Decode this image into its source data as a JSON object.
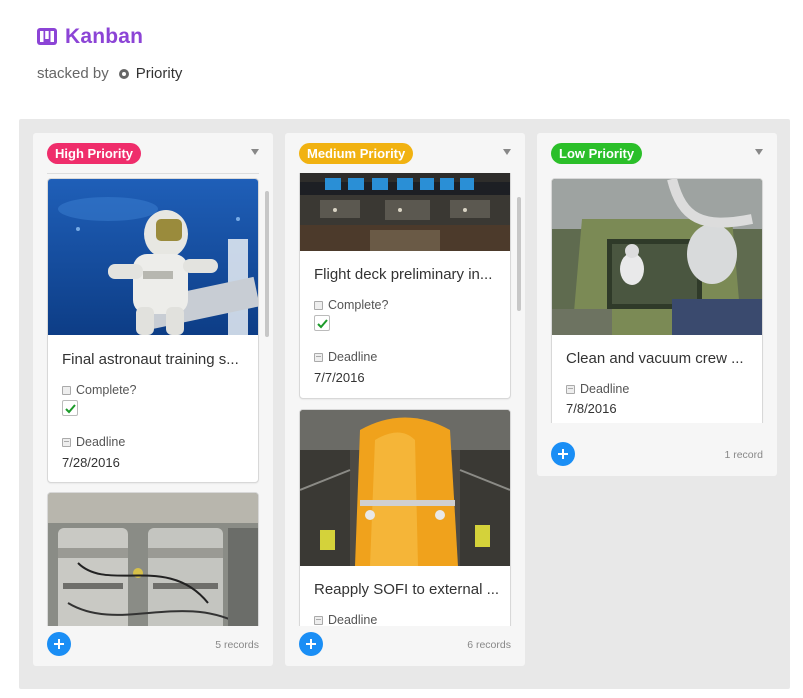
{
  "header": {
    "title": "Kanban",
    "stack_label": "stacked by",
    "stack_field": "Priority"
  },
  "columns": {
    "high": {
      "label": "High Priority",
      "color": "#ef2d6b",
      "count": "5 records",
      "cards": [
        {
          "title": "Final astronaut training s...",
          "complete_label": "Complete?",
          "complete": true,
          "deadline_label": "Deadline",
          "deadline": "7/28/2016"
        }
      ]
    },
    "medium": {
      "label": "Medium Priority",
      "color": "#f1b211",
      "count": "6 records",
      "cards": [
        {
          "title": "Flight deck preliminary in...",
          "complete_label": "Complete?",
          "complete": true,
          "deadline_label": "Deadline",
          "deadline": "7/7/2016"
        },
        {
          "title": "Reapply SOFI to external ...",
          "deadline_label": "Deadline"
        }
      ]
    },
    "low": {
      "label": "Low Priority",
      "color": "#2bbf29",
      "count": "1 record",
      "cards": [
        {
          "title": "Clean and vacuum crew ...",
          "deadline_label": "Deadline",
          "deadline": "7/8/2016"
        }
      ]
    }
  },
  "icons": {
    "app": "kanban-icon",
    "stack_field": "single-select-field-icon",
    "checkbox_field": "checkbox-field-icon",
    "date_field": "calendar-field-icon",
    "add": "plus-icon",
    "dropdown": "chevron-down-icon"
  },
  "accent_color": "#8c44d6",
  "add_button_color": "#1a8ef5"
}
